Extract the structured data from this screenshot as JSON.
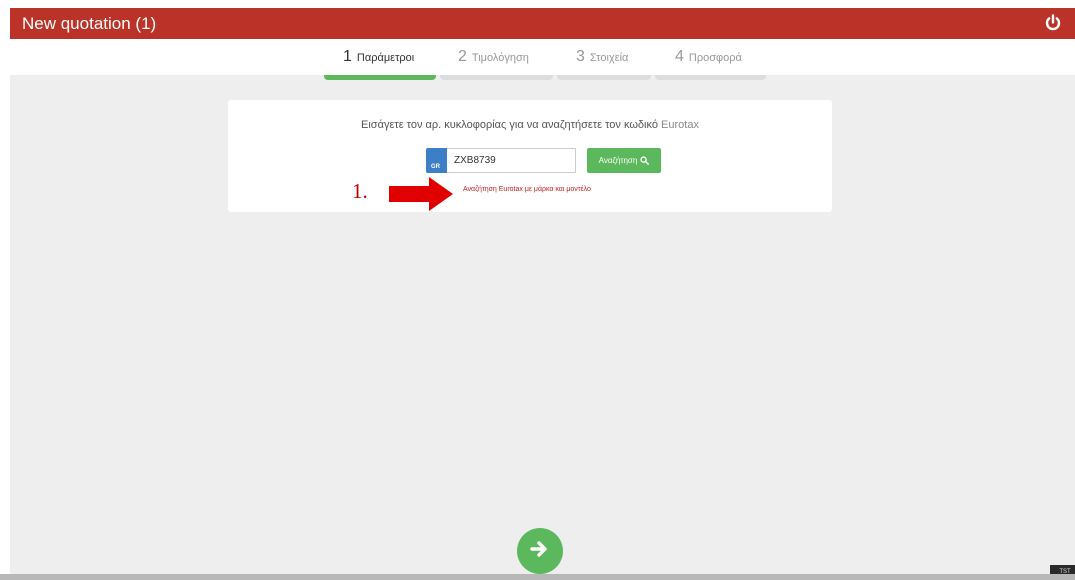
{
  "window": {
    "title": "New quotation (1)"
  },
  "steps": [
    {
      "num": "1",
      "label": "Παράμετροι"
    },
    {
      "num": "2",
      "label": "Τιμολόγηση"
    },
    {
      "num": "3",
      "label": "Στοιχεία"
    },
    {
      "num": "4",
      "label": "Προσφορά"
    }
  ],
  "search": {
    "prompt": "Εισάγετε τον αρ. κυκλοφορίας για να αναζητήσετε τον κωδικό",
    "prompt_brand": "Eurotax",
    "country_code": "GR",
    "plate_value": "ZXB8739",
    "button_label": "Αναζήτηση",
    "alt_link": "Αναζήτηση Eurotax με μάρκα και μοντέλο"
  },
  "annotation": {
    "label": "1."
  },
  "footer": {
    "env_badge": "TST"
  },
  "colors": {
    "titlebar": "#bb3228",
    "accent_green": "#5cb85c",
    "flag_blue": "#3c7fc6",
    "link_red": "#cc2222",
    "annotation_red": "#e00000"
  },
  "icons": {
    "power": "power-icon",
    "search": "search-icon",
    "next": "arrow-right-icon"
  }
}
